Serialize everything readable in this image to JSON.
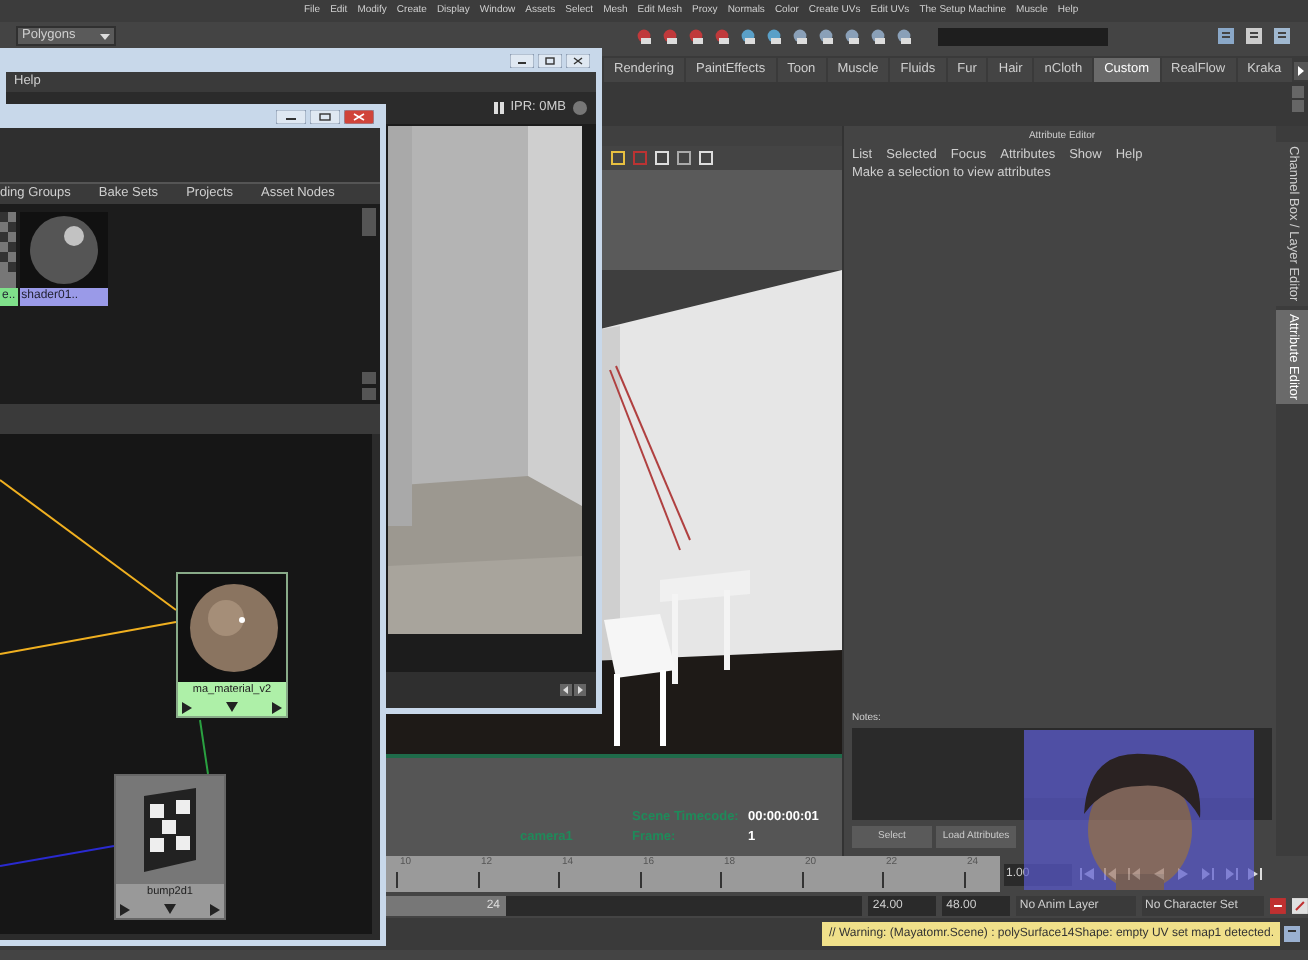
{
  "menu_bar": [
    "File",
    "Edit",
    "Modify",
    "Create",
    "Display",
    "Window",
    "Assets",
    "Select",
    "Mesh",
    "Edit Mesh",
    "Proxy",
    "Normals",
    "Color",
    "Create UVs",
    "Edit UVs",
    "The Setup Machine",
    "Muscle",
    "Help"
  ],
  "toolbar": {
    "mode_menu": "Polygons"
  },
  "shelf_tabs": [
    {
      "label": "Rendering",
      "selected": false
    },
    {
      "label": "PaintEffects",
      "selected": false
    },
    {
      "label": "Toon",
      "selected": false
    },
    {
      "label": "Muscle",
      "selected": false
    },
    {
      "label": "Fluids",
      "selected": false
    },
    {
      "label": "Fur",
      "selected": false
    },
    {
      "label": "Hair",
      "selected": false
    },
    {
      "label": "nCloth",
      "selected": false
    },
    {
      "label": "Custom",
      "selected": true
    },
    {
      "label": "RealFlow",
      "selected": false
    },
    {
      "label": "Kraka",
      "selected": false
    }
  ],
  "render_view": {
    "menu": [
      "Help"
    ],
    "ipr": "IPR: 0MB"
  },
  "hypershade": {
    "tabs": [
      "ding Groups",
      "Bake Sets",
      "Projects",
      "Asset Nodes"
    ],
    "swatches": [
      {
        "label": "e..",
        "kind": "checker",
        "color": "#7fe08a"
      },
      {
        "label": "shader01..",
        "kind": "sphere",
        "color": "#9a9ae8"
      }
    ],
    "nodes": [
      {
        "label": "ma_material_v2",
        "kind": "material"
      },
      {
        "label": "bump2d1",
        "kind": "texture"
      }
    ]
  },
  "viewport": {
    "camera": "camera1",
    "timecode_label": "Scene Timecode:",
    "timecode": "00:00:00:01",
    "frame_label": "Frame:",
    "frame": "1"
  },
  "attribute_editor": {
    "title": "Attribute Editor",
    "menu": [
      "List",
      "Selected",
      "Focus",
      "Attributes",
      "Show",
      "Help"
    ],
    "message": "Make a selection to view attributes",
    "notes_label": "Notes:",
    "buttons": [
      "Select",
      "Load Attributes"
    ]
  },
  "side_tabs": [
    {
      "label": "Channel Box / Layer Editor",
      "selected": false
    },
    {
      "label": "Attribute Editor",
      "selected": true
    }
  ],
  "timeline": {
    "ticks": [
      "10",
      "12",
      "14",
      "16",
      "18",
      "20",
      "22",
      "24"
    ],
    "current_time": "1.00"
  },
  "range_slider": {
    "range_end": "24",
    "end_time": "24.00",
    "max_time": "48.00",
    "anim_layer": "No Anim Layer",
    "character_set": "No Character Set"
  },
  "command_line": {
    "warning": "// Warning: (Mayatomr.Scene) : polySurface14Shape: empty UV set map1 detected."
  }
}
